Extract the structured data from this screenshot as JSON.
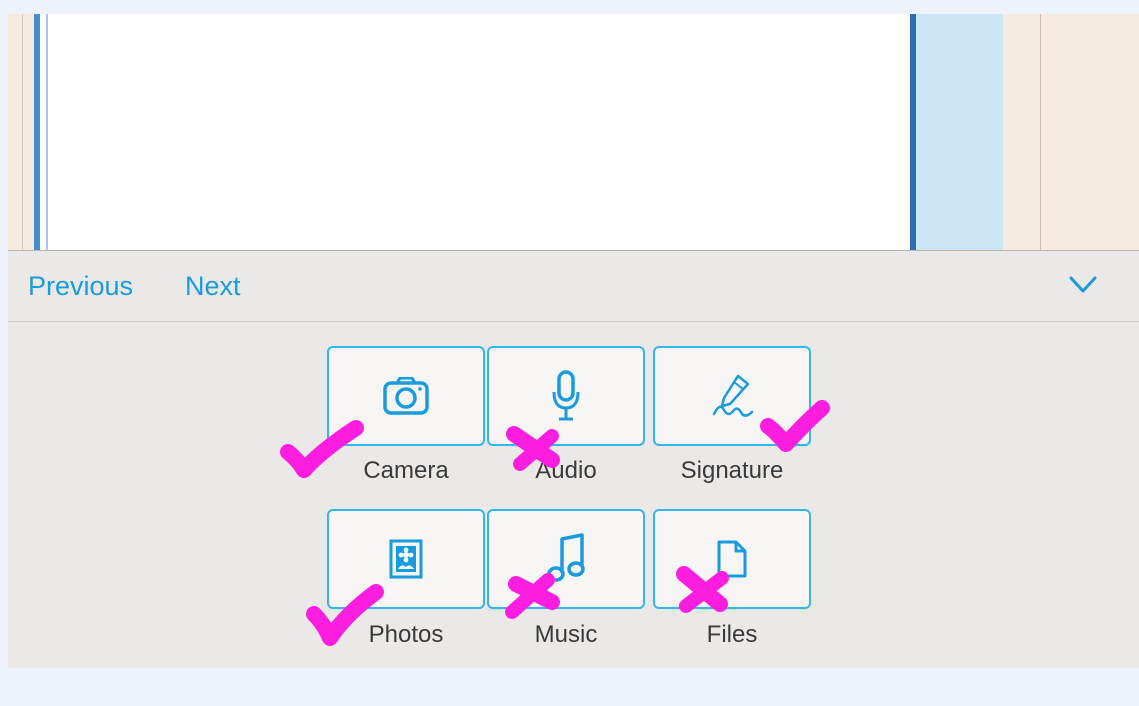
{
  "toolbar": {
    "previous_label": "Previous",
    "next_label": "Next",
    "collapse_icon": "chevron-down-icon"
  },
  "options": [
    {
      "label": "Camera",
      "icon": "camera-icon",
      "annotation": "check"
    },
    {
      "label": "Audio",
      "icon": "microphone-icon",
      "annotation": "cross"
    },
    {
      "label": "Signature",
      "icon": "signature-icon",
      "annotation": "check"
    },
    {
      "label": "Photos",
      "icon": "photo-icon",
      "annotation": "check"
    },
    {
      "label": "Music",
      "icon": "music-note-icon",
      "annotation": "cross"
    },
    {
      "label": "Files",
      "icon": "file-icon",
      "annotation": "cross"
    }
  ],
  "colors": {
    "accent": "#1a9bdc",
    "tile_border": "#35b6e6",
    "panel_bg": "#ebe9e7",
    "annotation": "#ff1ee0"
  }
}
